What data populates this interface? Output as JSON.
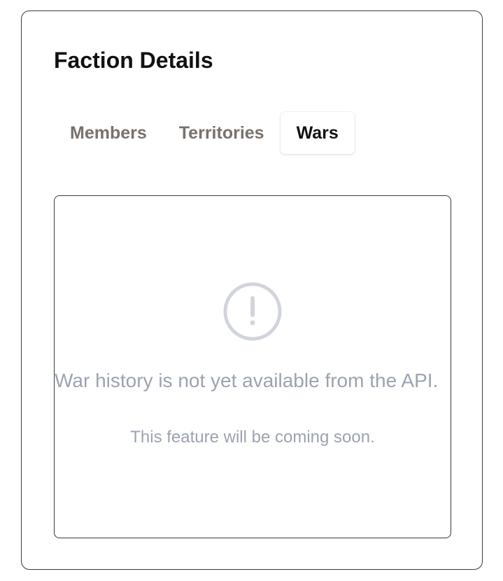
{
  "card": {
    "title": "Faction Details"
  },
  "tabs": [
    {
      "label": "Members",
      "active": false
    },
    {
      "label": "Territories",
      "active": false
    },
    {
      "label": "Wars",
      "active": true
    }
  ],
  "panel": {
    "icon": "alert-circle-icon",
    "message": "War history is not yet available from the API.",
    "submessage": "This feature will be coming soon."
  },
  "colors": {
    "tab_inactive": "#78716c",
    "tab_active": "#111111",
    "muted_text": "#9ca3af",
    "icon": "#d1d5db"
  }
}
